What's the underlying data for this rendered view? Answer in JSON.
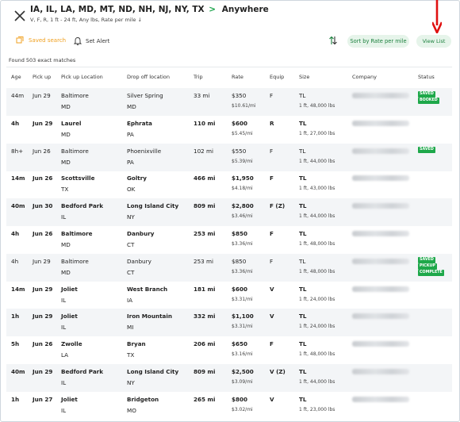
{
  "header": {
    "title_origins": "IA, IL, LA, MD, MT, ND, NH, NJ, NY, TX",
    "title_arrow": ">",
    "title_destination": "Anywhere",
    "subtitle": "V, F, R, 1 ft - 24 ft, Any lbs, Rate per mile ↓"
  },
  "toolbar": {
    "saved_search": "Saved search",
    "set_alert": "Set Alert",
    "sort_button": "Sort by Rate per mile",
    "view_button": "View List"
  },
  "results": {
    "found_text": "Found 503 exact matches"
  },
  "columns": [
    "Age",
    "Pick up",
    "Pick up Location",
    "Drop off location",
    "Trip",
    "Rate",
    "Equip",
    "Size",
    "Company",
    "Status"
  ],
  "rows": [
    {
      "age": "44m",
      "pickup": "Jun 29",
      "pu_city": "Baltimore",
      "pu_state": "MD",
      "do_city": "Silver Spring",
      "do_state": "MD",
      "trip": "33 mi",
      "rate": "$350",
      "rate_per_mile": "$10.61/mi",
      "equip": "F",
      "size": "TL",
      "size_detail": "1 ft, 48,000 lbs",
      "status": [
        "SAVED",
        "BOOKED"
      ],
      "bold": false
    },
    {
      "age": "4h",
      "pickup": "Jun 29",
      "pu_city": "Laurel",
      "pu_state": "MD",
      "do_city": "Ephrata",
      "do_state": "PA",
      "trip": "110 mi",
      "rate": "$600",
      "rate_per_mile": "$5.45/mi",
      "equip": "R",
      "size": "TL",
      "size_detail": "1 ft, 27,000 lbs",
      "status": [],
      "bold": true
    },
    {
      "age": "8h+",
      "pickup": "Jun 26",
      "pu_city": "Baltimore",
      "pu_state": "MD",
      "do_city": "Phoenixville",
      "do_state": "PA",
      "trip": "102 mi",
      "rate": "$550",
      "rate_per_mile": "$5.39/mi",
      "equip": "F",
      "size": "TL",
      "size_detail": "1 ft, 44,000 lbs",
      "status": [
        "SAVED"
      ],
      "bold": false
    },
    {
      "age": "14m",
      "pickup": "Jun 26",
      "pu_city": "Scottsville",
      "pu_state": "TX",
      "do_city": "Goltry",
      "do_state": "OK",
      "trip": "466 mi",
      "rate": "$1,950",
      "rate_per_mile": "$4.18/mi",
      "equip": "F",
      "size": "TL",
      "size_detail": "1 ft, 43,000 lbs",
      "status": [],
      "bold": true
    },
    {
      "age": "40m",
      "pickup": "Jun 30",
      "pu_city": "Bedford Park",
      "pu_state": "IL",
      "do_city": "Long Island City",
      "do_state": "NY",
      "trip": "809 mi",
      "rate": "$2,800",
      "rate_per_mile": "$3.46/mi",
      "equip": "F (Z)",
      "size": "TL",
      "size_detail": "1 ft, 44,000 lbs",
      "status": [],
      "bold": true
    },
    {
      "age": "4h",
      "pickup": "Jun 26",
      "pu_city": "Baltimore",
      "pu_state": "MD",
      "do_city": "Danbury",
      "do_state": "CT",
      "trip": "253 mi",
      "rate": "$850",
      "rate_per_mile": "$3.36/mi",
      "equip": "F",
      "size": "TL",
      "size_detail": "1 ft, 48,000 lbs",
      "status": [],
      "bold": true
    },
    {
      "age": "4h",
      "pickup": "Jun 29",
      "pu_city": "Baltimore",
      "pu_state": "MD",
      "do_city": "Danbury",
      "do_state": "CT",
      "trip": "253 mi",
      "rate": "$850",
      "rate_per_mile": "$3.36/mi",
      "equip": "F",
      "size": "TL",
      "size_detail": "1 ft, 48,000 lbs",
      "status": [
        "SAVED",
        "PICKUP",
        "COMPLETE"
      ],
      "bold": false
    },
    {
      "age": "14m",
      "pickup": "Jun 29",
      "pu_city": "Joliet",
      "pu_state": "IL",
      "do_city": "West Branch",
      "do_state": "IA",
      "trip": "181 mi",
      "rate": "$600",
      "rate_per_mile": "$3.31/mi",
      "equip": "V",
      "size": "TL",
      "size_detail": "1 ft, 24,000 lbs",
      "status": [],
      "bold": true
    },
    {
      "age": "1h",
      "pickup": "Jun 29",
      "pu_city": "Joliet",
      "pu_state": "IL",
      "do_city": "Iron Mountain",
      "do_state": "MI",
      "trip": "332 mi",
      "rate": "$1,100",
      "rate_per_mile": "$3.31/mi",
      "equip": "V",
      "size": "TL",
      "size_detail": "1 ft, 24,000 lbs",
      "status": [],
      "bold": true
    },
    {
      "age": "5h",
      "pickup": "Jun 26",
      "pu_city": "Zwolle",
      "pu_state": "LA",
      "do_city": "Bryan",
      "do_state": "TX",
      "trip": "206 mi",
      "rate": "$650",
      "rate_per_mile": "$3.16/mi",
      "equip": "F",
      "size": "TL",
      "size_detail": "1 ft, 48,000 lbs",
      "status": [],
      "bold": true
    },
    {
      "age": "40m",
      "pickup": "Jun 29",
      "pu_city": "Bedford Park",
      "pu_state": "IL",
      "do_city": "Long Island City",
      "do_state": "NY",
      "trip": "809 mi",
      "rate": "$2,500",
      "rate_per_mile": "$3.09/mi",
      "equip": "V (Z)",
      "size": "TL",
      "size_detail": "1 ft, 44,000 lbs",
      "status": [],
      "bold": true
    },
    {
      "age": "1h",
      "pickup": "Jun 27",
      "pu_city": "Joliet",
      "pu_state": "IL",
      "do_city": "Bridgeton",
      "do_state": "MO",
      "trip": "265 mi",
      "rate": "$800",
      "rate_per_mile": "$3.02/mi",
      "equip": "V",
      "size": "TL",
      "size_detail": "1 ft, 23,000 lbs",
      "status": [],
      "bold": true
    }
  ],
  "colors": {
    "accent_green": "#1aa34a",
    "badge_green": "#1ea84a",
    "saved_orange": "#f0a020",
    "annotation_red": "#e01010"
  }
}
